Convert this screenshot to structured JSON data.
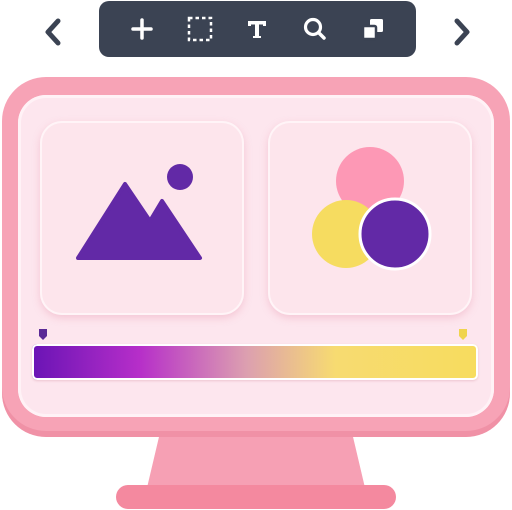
{
  "toolbar": {
    "tools": [
      {
        "icon": "move-icon"
      },
      {
        "icon": "marquee-select-icon"
      },
      {
        "icon": "text-tool-icon"
      },
      {
        "icon": "zoom-icon"
      },
      {
        "icon": "layers-icon"
      }
    ],
    "prev_icon": "chevron-left-icon",
    "next_icon": "chevron-right-icon"
  },
  "cards": [
    {
      "icon": "image-landscape-icon"
    },
    {
      "icon": "color-circles-icon"
    }
  ],
  "gradient": {
    "stops": [
      {
        "color": "#6a14b5",
        "position": 0
      },
      {
        "color": "#f7dc5e",
        "position": 1
      }
    ]
  },
  "colors": {
    "toolbar_bg": "#3b4353",
    "monitor_frame": "#f7a3b6",
    "screen": "#fde6ee",
    "purple": "#6229a6",
    "pink": "#fd98b5",
    "yellow": "#f6dc60"
  }
}
